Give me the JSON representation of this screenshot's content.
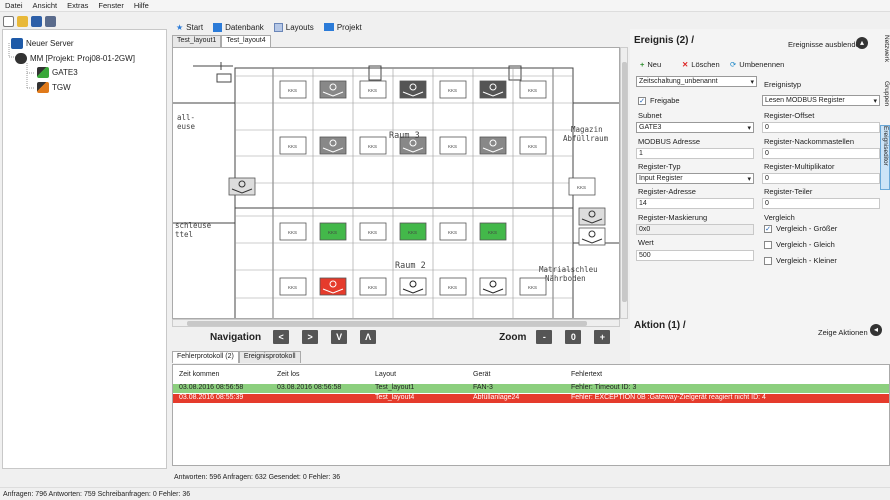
{
  "menu": [
    "Datei",
    "Ansicht",
    "Extras",
    "Fenster",
    "Hilfe"
  ],
  "toolbar_icons": [
    "new-file-icon",
    "open-folder-icon",
    "save-icon",
    "connect-icon"
  ],
  "tree": {
    "root": "Neuer Server",
    "project": "MM [Projekt: Proj08-01-2GW]",
    "children": [
      "GATE3",
      "TGW"
    ]
  },
  "topnav": [
    "Start",
    "Datenbank",
    "Layouts",
    "Projekt"
  ],
  "doc_tabs": [
    "Test_layout1",
    "Test_layout4"
  ],
  "floorplan": {
    "room3": "Raum 3",
    "room2": "Raum 2",
    "magazin": "Magazin\nAbfüllraum",
    "matrial": "Matrialschleu\nNährboden",
    "schleuse": "schleuse\nttel",
    "left_top": "all-\neuse",
    "kks": "KKS"
  },
  "navigation": {
    "label": "Navigation",
    "buttons": [
      "<",
      ">",
      "V",
      "Λ"
    ]
  },
  "zoom": {
    "label": "Zoom",
    "buttons": [
      "-",
      "0",
      "+"
    ]
  },
  "ereignis": {
    "title": "Ereignis (2) /",
    "hide_label": "Ereignisse ausblenden",
    "new": "Neu",
    "delete": "Löschen",
    "rename": "Umbenennen",
    "event_select": "Zeitschaltung_unbenannt",
    "ereignistyp_label": "Ereignistyp",
    "freigabe": "Freigabe",
    "ereignistyp_value": "Lesen MODBUS Register",
    "subnet_label": "Subnet",
    "subnet_value": "GATE3",
    "reg_offset_label": "Register-Offset",
    "reg_offset_value": "0",
    "modbus_label": "MODBUS Adresse",
    "modbus_value": "1",
    "reg_nachkomma_label": "Register-Nackommastellen",
    "reg_nachkomma_value": "0",
    "reg_typ_label": "Register-Typ",
    "reg_typ_value": "Input Register",
    "reg_mult_label": "Register-Multiplikator",
    "reg_mult_value": "0",
    "reg_adr_label": "Register-Adresse",
    "reg_adr_value": "14",
    "reg_teiler_label": "Register-Teiler",
    "reg_teiler_value": "0",
    "reg_mask_label": "Register-Maskierung",
    "reg_mask_value": "0x0",
    "vergleich_label": "Vergleich",
    "wert_label": "Wert",
    "wert_value": "500",
    "cmp_gt": "Vergleich - Größer",
    "cmp_eq": "Vergleich - Gleich",
    "cmp_lt": "Vergleich - Kleiner"
  },
  "aktion": {
    "title": "Aktion (1) /",
    "show_label": "Zeige Aktionen"
  },
  "side_tabs": [
    "Netzwerk",
    "Gruppen",
    "Ereigniseditor"
  ],
  "bottom_tabs": [
    "Fehlerprotokoll (2)",
    "Ereignisprotokoll"
  ],
  "error_table": {
    "headers": [
      "Zeit kommen",
      "Zeit los",
      "Layout",
      "Gerät",
      "Fehlertext"
    ],
    "rows": [
      {
        "kommen": "03.08.2016 08:56:58",
        "los": "03.08.2016 08:56:58",
        "layout": "Test_layout1",
        "geraet": "FAN-3",
        "text": "Fehler: Timeout ID: 3",
        "status": "green"
      },
      {
        "kommen": "03.08.2016 08:55:39",
        "los": "",
        "layout": "Test_layout4",
        "geraet": "Abfüllanlage24",
        "text": "Fehler: EXCEPTION 0B :Gateway-Zielgerät reagiert nicht ID: 4",
        "status": "red"
      }
    ]
  },
  "status_inner": "Antworten: 596  Anfragen: 632  Gesendet: 0  Fehler: 36",
  "status_bottom": "Anfragen: 796  Antworten: 759  Schreibanfragen: 0  Fehler: 36",
  "colors": {
    "green": "#8ccf7e",
    "red": "#e53b2c",
    "navy": "#1e3a6e",
    "accent": "#1e88c8"
  }
}
